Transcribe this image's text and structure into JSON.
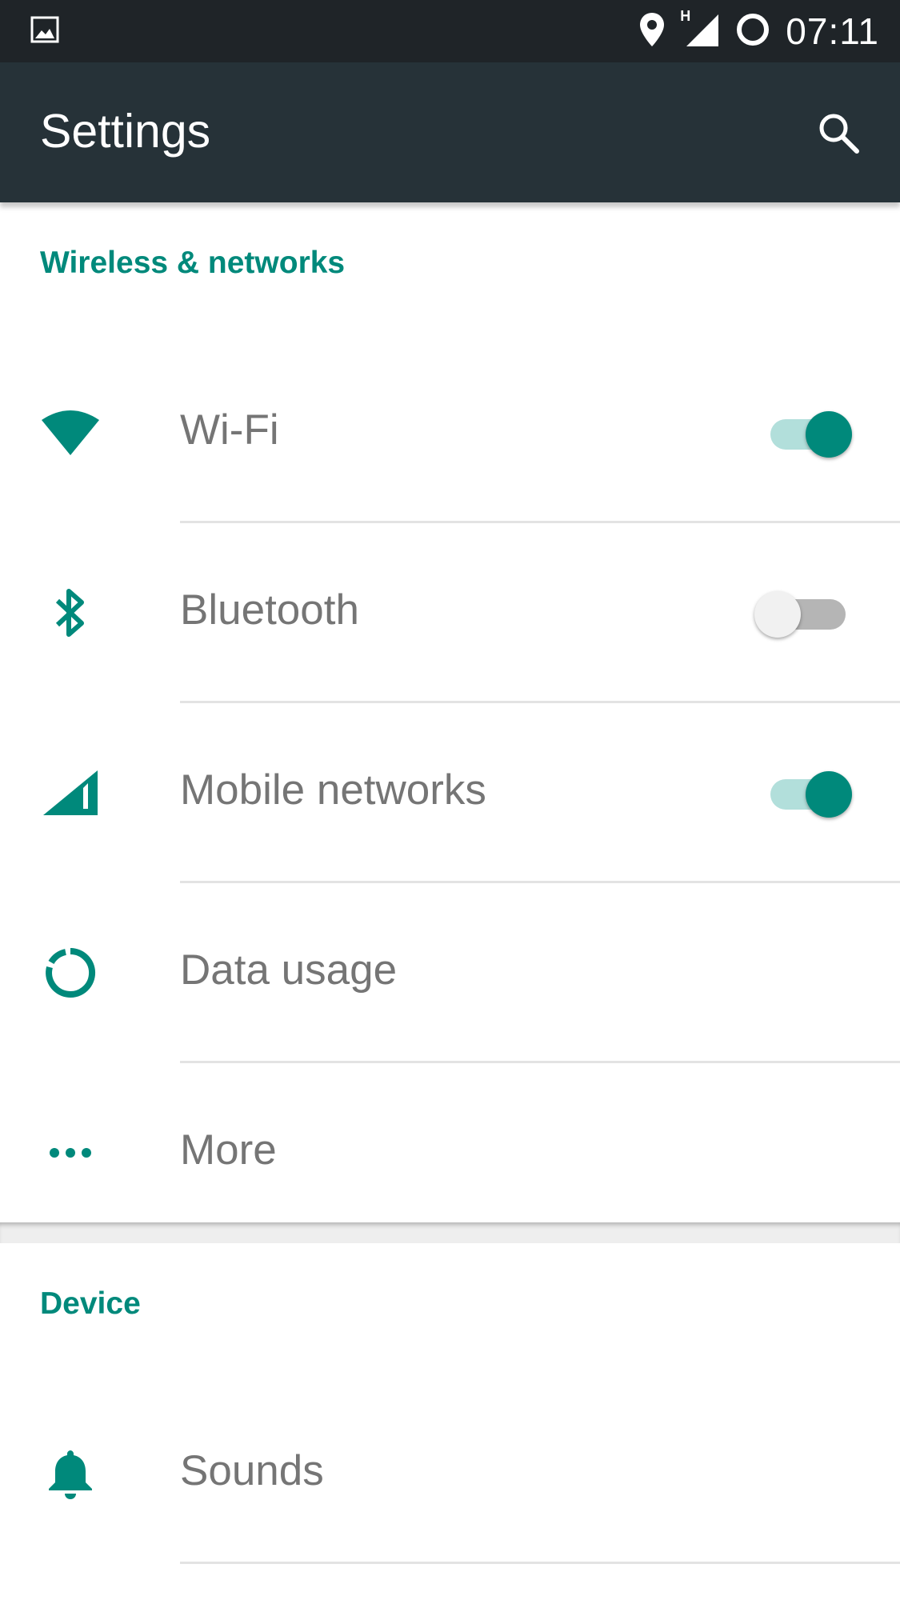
{
  "status_bar": {
    "time": "07:11",
    "network_type": "H",
    "icons": [
      "image-icon",
      "location-icon",
      "signal-icon",
      "data-saver-icon"
    ]
  },
  "app_bar": {
    "title": "Settings",
    "search_icon": "search-icon"
  },
  "sections": [
    {
      "header": "Wireless & networks",
      "items": [
        {
          "label": "Wi-Fi",
          "icon": "wifi-icon",
          "toggle": "on"
        },
        {
          "label": "Bluetooth",
          "icon": "bluetooth-icon",
          "toggle": "off"
        },
        {
          "label": "Mobile networks",
          "icon": "signal-icon",
          "toggle": "on"
        },
        {
          "label": "Data usage",
          "icon": "data-usage-icon"
        },
        {
          "label": "More",
          "icon": "more-icon"
        }
      ]
    },
    {
      "header": "Device",
      "items": [
        {
          "label": "Sounds",
          "icon": "bell-icon"
        }
      ]
    }
  ],
  "colors": {
    "accent": "#00897b",
    "accent_light": "#b2dfdb",
    "app_bar": "#263238",
    "status_bar": "#1f2428",
    "label_text": "#757575"
  }
}
